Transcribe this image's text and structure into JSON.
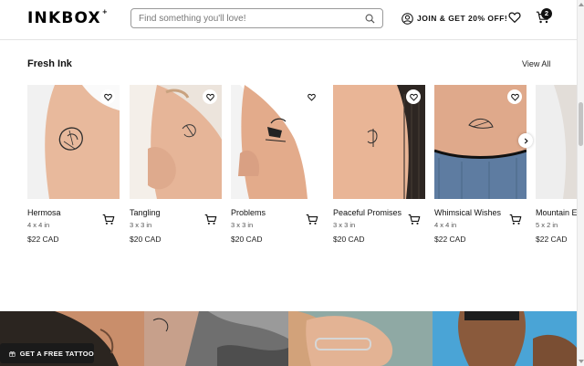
{
  "header": {
    "logo": "INKBOX",
    "logo_mark": "+",
    "search_placeholder": "Find something you'll love!",
    "account_label": "JOIN & GET 20% OFF!",
    "cart_count": "2",
    "icons": {
      "search": "search-icon",
      "account": "user-circle-icon",
      "wishlist": "heart-icon",
      "cart": "cart-icon"
    }
  },
  "section": {
    "title": "Fresh Ink",
    "view_all": "View All"
  },
  "products": [
    {
      "name": "Hermosa",
      "size": "4 x 4 in",
      "price": "$22 CAD"
    },
    {
      "name": "Tangling",
      "size": "3 x 3 in",
      "price": "$20 CAD"
    },
    {
      "name": "Problems",
      "size": "3 x 3 in",
      "price": "$20 CAD"
    },
    {
      "name": "Peaceful Promises",
      "size": "3 x 3 in",
      "price": "$20 CAD"
    },
    {
      "name": "Whimsical Wishes",
      "size": "4 x 4 in",
      "price": "$22 CAD"
    },
    {
      "name": "Mountain Es",
      "size": "5 x 2 in",
      "price": "$22 CAD"
    }
  ],
  "promo": {
    "label": "GET A FREE TATTOO",
    "icon": "gift-icon"
  },
  "colors": {
    "text": "#111111",
    "muted": "#555555",
    "skin": "#e7b89a",
    "promo_bg": "#1a1a1a"
  }
}
